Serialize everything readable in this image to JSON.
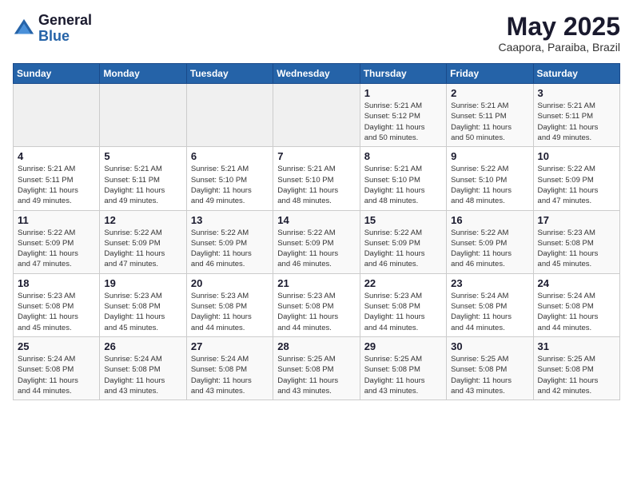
{
  "header": {
    "logo_general": "General",
    "logo_blue": "Blue",
    "month_title": "May 2025",
    "location": "Caapora, Paraiba, Brazil"
  },
  "calendar": {
    "weekdays": [
      "Sunday",
      "Monday",
      "Tuesday",
      "Wednesday",
      "Thursday",
      "Friday",
      "Saturday"
    ],
    "weeks": [
      [
        {
          "day": "",
          "info": ""
        },
        {
          "day": "",
          "info": ""
        },
        {
          "day": "",
          "info": ""
        },
        {
          "day": "",
          "info": ""
        },
        {
          "day": "1",
          "info": "Sunrise: 5:21 AM\nSunset: 5:12 PM\nDaylight: 11 hours\nand 50 minutes."
        },
        {
          "day": "2",
          "info": "Sunrise: 5:21 AM\nSunset: 5:11 PM\nDaylight: 11 hours\nand 50 minutes."
        },
        {
          "day": "3",
          "info": "Sunrise: 5:21 AM\nSunset: 5:11 PM\nDaylight: 11 hours\nand 49 minutes."
        }
      ],
      [
        {
          "day": "4",
          "info": "Sunrise: 5:21 AM\nSunset: 5:11 PM\nDaylight: 11 hours\nand 49 minutes."
        },
        {
          "day": "5",
          "info": "Sunrise: 5:21 AM\nSunset: 5:11 PM\nDaylight: 11 hours\nand 49 minutes."
        },
        {
          "day": "6",
          "info": "Sunrise: 5:21 AM\nSunset: 5:10 PM\nDaylight: 11 hours\nand 49 minutes."
        },
        {
          "day": "7",
          "info": "Sunrise: 5:21 AM\nSunset: 5:10 PM\nDaylight: 11 hours\nand 48 minutes."
        },
        {
          "day": "8",
          "info": "Sunrise: 5:21 AM\nSunset: 5:10 PM\nDaylight: 11 hours\nand 48 minutes."
        },
        {
          "day": "9",
          "info": "Sunrise: 5:22 AM\nSunset: 5:10 PM\nDaylight: 11 hours\nand 48 minutes."
        },
        {
          "day": "10",
          "info": "Sunrise: 5:22 AM\nSunset: 5:09 PM\nDaylight: 11 hours\nand 47 minutes."
        }
      ],
      [
        {
          "day": "11",
          "info": "Sunrise: 5:22 AM\nSunset: 5:09 PM\nDaylight: 11 hours\nand 47 minutes."
        },
        {
          "day": "12",
          "info": "Sunrise: 5:22 AM\nSunset: 5:09 PM\nDaylight: 11 hours\nand 47 minutes."
        },
        {
          "day": "13",
          "info": "Sunrise: 5:22 AM\nSunset: 5:09 PM\nDaylight: 11 hours\nand 46 minutes."
        },
        {
          "day": "14",
          "info": "Sunrise: 5:22 AM\nSunset: 5:09 PM\nDaylight: 11 hours\nand 46 minutes."
        },
        {
          "day": "15",
          "info": "Sunrise: 5:22 AM\nSunset: 5:09 PM\nDaylight: 11 hours\nand 46 minutes."
        },
        {
          "day": "16",
          "info": "Sunrise: 5:22 AM\nSunset: 5:09 PM\nDaylight: 11 hours\nand 46 minutes."
        },
        {
          "day": "17",
          "info": "Sunrise: 5:23 AM\nSunset: 5:08 PM\nDaylight: 11 hours\nand 45 minutes."
        }
      ],
      [
        {
          "day": "18",
          "info": "Sunrise: 5:23 AM\nSunset: 5:08 PM\nDaylight: 11 hours\nand 45 minutes."
        },
        {
          "day": "19",
          "info": "Sunrise: 5:23 AM\nSunset: 5:08 PM\nDaylight: 11 hours\nand 45 minutes."
        },
        {
          "day": "20",
          "info": "Sunrise: 5:23 AM\nSunset: 5:08 PM\nDaylight: 11 hours\nand 44 minutes."
        },
        {
          "day": "21",
          "info": "Sunrise: 5:23 AM\nSunset: 5:08 PM\nDaylight: 11 hours\nand 44 minutes."
        },
        {
          "day": "22",
          "info": "Sunrise: 5:23 AM\nSunset: 5:08 PM\nDaylight: 11 hours\nand 44 minutes."
        },
        {
          "day": "23",
          "info": "Sunrise: 5:24 AM\nSunset: 5:08 PM\nDaylight: 11 hours\nand 44 minutes."
        },
        {
          "day": "24",
          "info": "Sunrise: 5:24 AM\nSunset: 5:08 PM\nDaylight: 11 hours\nand 44 minutes."
        }
      ],
      [
        {
          "day": "25",
          "info": "Sunrise: 5:24 AM\nSunset: 5:08 PM\nDaylight: 11 hours\nand 44 minutes."
        },
        {
          "day": "26",
          "info": "Sunrise: 5:24 AM\nSunset: 5:08 PM\nDaylight: 11 hours\nand 43 minutes."
        },
        {
          "day": "27",
          "info": "Sunrise: 5:24 AM\nSunset: 5:08 PM\nDaylight: 11 hours\nand 43 minutes."
        },
        {
          "day": "28",
          "info": "Sunrise: 5:25 AM\nSunset: 5:08 PM\nDaylight: 11 hours\nand 43 minutes."
        },
        {
          "day": "29",
          "info": "Sunrise: 5:25 AM\nSunset: 5:08 PM\nDaylight: 11 hours\nand 43 minutes."
        },
        {
          "day": "30",
          "info": "Sunrise: 5:25 AM\nSunset: 5:08 PM\nDaylight: 11 hours\nand 43 minutes."
        },
        {
          "day": "31",
          "info": "Sunrise: 5:25 AM\nSunset: 5:08 PM\nDaylight: 11 hours\nand 42 minutes."
        }
      ]
    ]
  }
}
